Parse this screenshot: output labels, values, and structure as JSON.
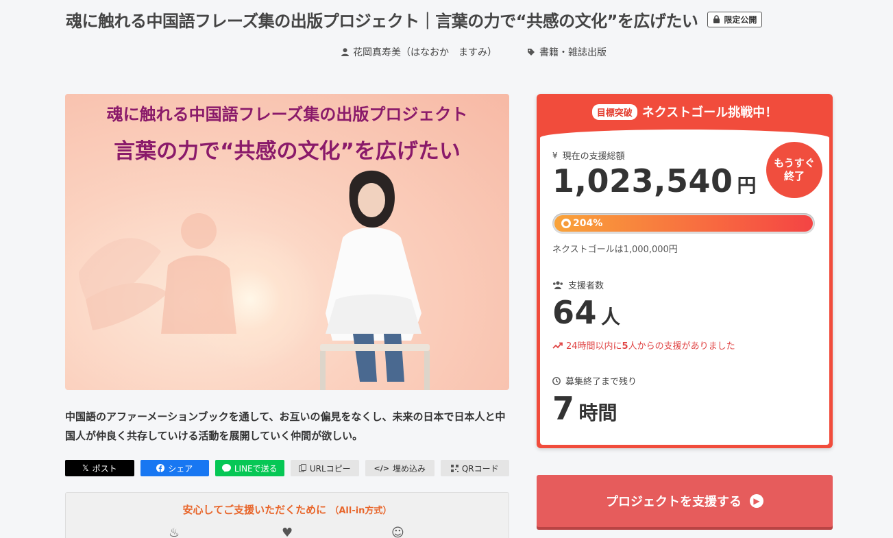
{
  "header": {
    "title": "魂に触れる中国語フレーズ集の出版プロジェクト｜言葉の力で“共感の文化”を広げたい",
    "limited_label": "限定公開",
    "author": "花岡真寿美（はなおか　ますみ）",
    "category": "書籍・雑誌出版"
  },
  "hero": {
    "line1": "魂に触れる中国語フレーズ集の出版プロジェクト",
    "line2": "言葉の力で“共感の文化”を広げたい"
  },
  "description": "中国語のアファーメーションブックを通して、お互いの偏見をなくし、未来の日本で日本人と中国人が仲良く共存していける活動を展開していく仲間が欲しい。",
  "share": {
    "post": "ポスト",
    "share": "シェア",
    "line": "LINEで送る",
    "url_copy": "URLコピー",
    "embed": "埋め込み",
    "qr": "QRコード"
  },
  "assurance": {
    "title": "安心してご支援いただくために",
    "mode": "（All-in方式）"
  },
  "panel": {
    "badge": "目標突破",
    "heading": "ネクストゴール挑戦中！",
    "total_label": "現在の支援総額",
    "total_value": "1,023,540",
    "total_unit": "円",
    "soon_line1": "もうすぐ",
    "soon_line2": "終了",
    "progress_percent_label": "204%",
    "progress_fraction": 1.0,
    "next_goal": "ネクストゴールは1,000,000円",
    "supporters_label": "支援者数",
    "supporters_value": "64",
    "supporters_unit": "人",
    "recent_prefix": "24時間以内に",
    "recent_count": "5",
    "recent_suffix": "人からの支援がありました",
    "remaining_label": "募集終了まで残り",
    "remaining_value": "7",
    "remaining_unit": "時間"
  },
  "cta": {
    "label": "プロジェクトを支援する"
  },
  "colors": {
    "accent": "#f14c3c",
    "cta": "#e65c5c",
    "hero_text": "#8a1a6a"
  }
}
